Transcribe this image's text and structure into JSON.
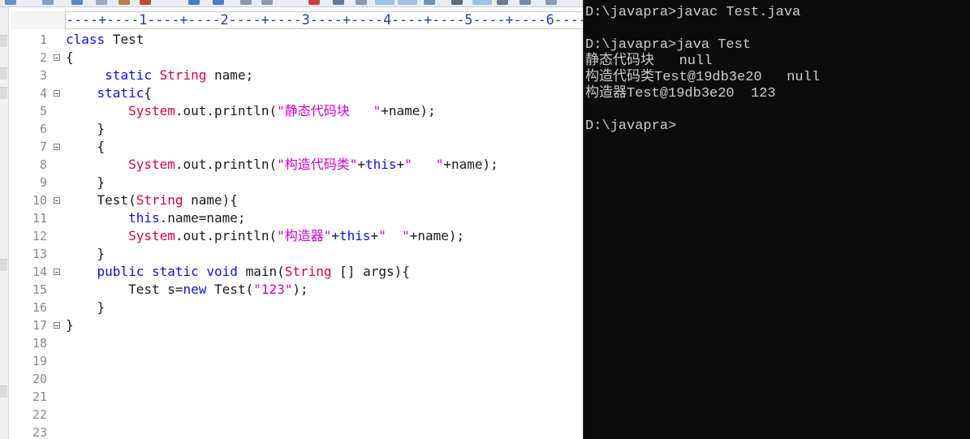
{
  "editor": {
    "ruler": "----+----1----+----2----+----3----+----4----+----5----+----6----",
    "line_numbers": [
      "1",
      "2",
      "3",
      "4",
      "5",
      "6",
      "7",
      "8",
      "9",
      "10",
      "11",
      "12",
      "13",
      "14",
      "15",
      "16",
      "17",
      "18",
      "19",
      "20",
      "21",
      "22",
      "23"
    ],
    "fold_lines": [
      2,
      4,
      7,
      10,
      14,
      17
    ],
    "lines": [
      [
        {
          "t": "class",
          "c": "kw"
        },
        {
          "t": " Test",
          "c": "pl"
        }
      ],
      [
        {
          "t": "{",
          "c": "pl"
        }
      ],
      [
        {
          "t": "     ",
          "c": "pl"
        },
        {
          "t": "static",
          "c": "kw"
        },
        {
          "t": " ",
          "c": "pl"
        },
        {
          "t": "String",
          "c": "ty"
        },
        {
          "t": " name;",
          "c": "pl"
        }
      ],
      [
        {
          "t": "    ",
          "c": "pl"
        },
        {
          "t": "static",
          "c": "kw"
        },
        {
          "t": "{",
          "c": "pl"
        }
      ],
      [
        {
          "t": "        ",
          "c": "pl"
        },
        {
          "t": "System",
          "c": "ty"
        },
        {
          "t": ".out.println(",
          "c": "pl"
        },
        {
          "t": "\"静态代码块   \"",
          "c": "st"
        },
        {
          "t": "+name);",
          "c": "pl"
        }
      ],
      [
        {
          "t": "    }",
          "c": "pl"
        }
      ],
      [
        {
          "t": "    {",
          "c": "pl"
        }
      ],
      [
        {
          "t": "        ",
          "c": "pl"
        },
        {
          "t": "System",
          "c": "ty"
        },
        {
          "t": ".out.println(",
          "c": "pl"
        },
        {
          "t": "\"构造代码类\"",
          "c": "st"
        },
        {
          "t": "+",
          "c": "pl"
        },
        {
          "t": "this",
          "c": "kw"
        },
        {
          "t": "+",
          "c": "pl"
        },
        {
          "t": "\"   \"",
          "c": "st"
        },
        {
          "t": "+name);",
          "c": "pl"
        }
      ],
      [
        {
          "t": "    }",
          "c": "pl"
        }
      ],
      [
        {
          "t": "    Test(",
          "c": "pl"
        },
        {
          "t": "String",
          "c": "ty"
        },
        {
          "t": " name){",
          "c": "pl"
        }
      ],
      [
        {
          "t": "        ",
          "c": "pl"
        },
        {
          "t": "this",
          "c": "kw"
        },
        {
          "t": ".name=name;",
          "c": "pl"
        }
      ],
      [
        {
          "t": "        ",
          "c": "pl"
        },
        {
          "t": "System",
          "c": "ty"
        },
        {
          "t": ".out.println(",
          "c": "pl"
        },
        {
          "t": "\"构造器\"",
          "c": "st"
        },
        {
          "t": "+",
          "c": "pl"
        },
        {
          "t": "this",
          "c": "kw"
        },
        {
          "t": "+",
          "c": "pl"
        },
        {
          "t": "\"  \"",
          "c": "st"
        },
        {
          "t": "+name);",
          "c": "pl"
        }
      ],
      [
        {
          "t": "    }",
          "c": "pl"
        }
      ],
      [
        {
          "t": "    ",
          "c": "pl"
        },
        {
          "t": "public",
          "c": "kw"
        },
        {
          "t": " ",
          "c": "pl"
        },
        {
          "t": "static",
          "c": "kw"
        },
        {
          "t": " ",
          "c": "pl"
        },
        {
          "t": "void",
          "c": "kw"
        },
        {
          "t": " main(",
          "c": "pl"
        },
        {
          "t": "String",
          "c": "ty"
        },
        {
          "t": " [] args){",
          "c": "pl"
        }
      ],
      [
        {
          "t": "        Test s=",
          "c": "pl"
        },
        {
          "t": "new",
          "c": "kw"
        },
        {
          "t": " Test(",
          "c": "pl"
        },
        {
          "t": "\"123\"",
          "c": "st"
        },
        {
          "t": ");",
          "c": "pl"
        }
      ],
      [
        {
          "t": "    }",
          "c": "pl"
        }
      ],
      [
        {
          "t": "}",
          "c": "pl"
        }
      ]
    ]
  },
  "console": {
    "lines": [
      "D:\\javapra>javac Test.java",
      "",
      "D:\\javapra>java Test",
      "静态代码块   null",
      "构造代码类Test@19db3e20   null",
      "构造器Test@19db3e20  123",
      "",
      "D:\\javapra>"
    ]
  }
}
